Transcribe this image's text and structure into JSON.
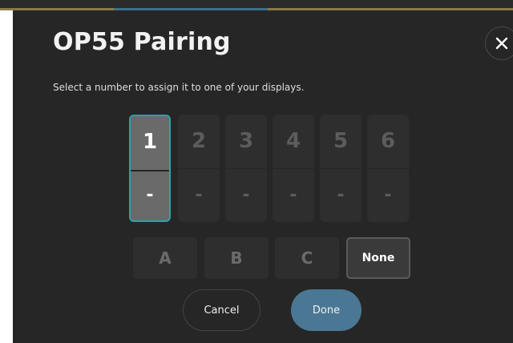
{
  "dialog": {
    "title": "OP55 Pairing",
    "subtitle": "Select a number to assign it to one of your displays.",
    "close_icon": "close-icon"
  },
  "slots": [
    {
      "number": "1",
      "value": "-",
      "selected": true
    },
    {
      "number": "2",
      "value": "-",
      "selected": false
    },
    {
      "number": "3",
      "value": "-",
      "selected": false
    },
    {
      "number": "4",
      "value": "-",
      "selected": false
    },
    {
      "number": "5",
      "value": "-",
      "selected": false
    },
    {
      "number": "6",
      "value": "-",
      "selected": false
    }
  ],
  "groups": [
    {
      "label": "A",
      "selected": false
    },
    {
      "label": "B",
      "selected": false
    },
    {
      "label": "C",
      "selected": false
    },
    {
      "label": "None",
      "selected": true
    }
  ],
  "actions": {
    "cancel_label": "Cancel",
    "done_label": "Done"
  },
  "colors": {
    "dialog_bg": "#262626",
    "selected_outline": "#2aa3a8",
    "primary_button": "#4a7894"
  }
}
